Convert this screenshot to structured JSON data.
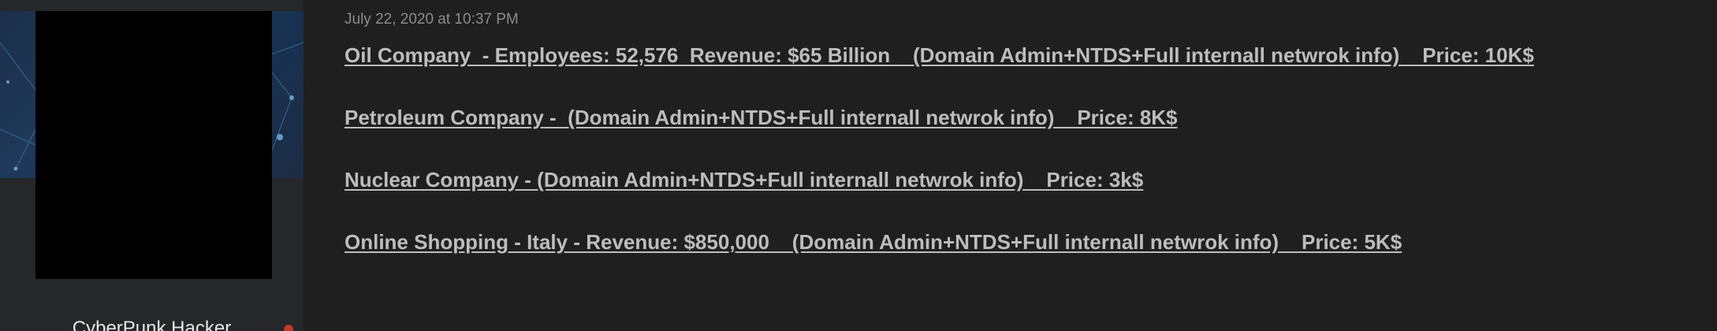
{
  "author": {
    "username": "CyberPunk Hacker",
    "status_color": "#c0392b"
  },
  "post": {
    "date": "July 22, 2020 at 10:37 PM",
    "listings": [
      "Oil Company  - Employees: 52,576  Revenue: $65 Billion    (Domain Admin+NTDS+Full internall netwrok info)    Price: 10K$",
      "Petroleum Company -  (Domain Admin+NTDS+Full internall netwrok info)    Price: 8K$",
      "Nuclear Company - (Domain Admin+NTDS+Full internall netwrok info)    Price: 3k$",
      "Online Shopping - Italy - Revenue: $850,000    (Domain Admin+NTDS+Full internall netwrok info)    Price: 5K$"
    ]
  }
}
